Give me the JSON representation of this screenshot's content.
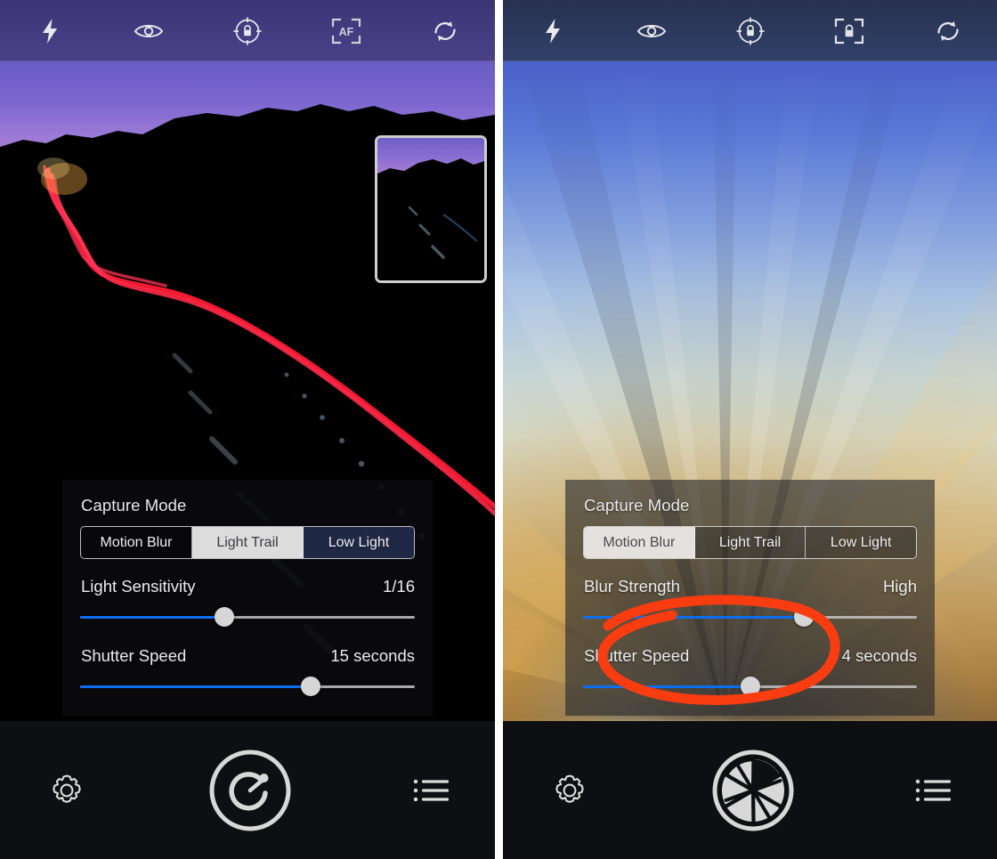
{
  "app": {
    "type": "mobile-camera-app-long-exposure",
    "panel_count": 2
  },
  "screens": [
    {
      "id": "left",
      "top_bar": {
        "buttons": [
          {
            "name": "flash-icon",
            "label": "Flash"
          },
          {
            "name": "eye-icon",
            "label": "Preview"
          },
          {
            "name": "exposure-lock-icon",
            "label": "AE Lock"
          },
          {
            "name": "af-icon",
            "label": "AF",
            "text": "AF"
          },
          {
            "name": "camera-flip-icon",
            "label": "Switch Camera"
          }
        ],
        "bg_color": "#443c80"
      },
      "thumbnail": {
        "label": "Last Capture Preview"
      },
      "panel": {
        "title": "Capture Mode",
        "segments": [
          {
            "label": "Motion Blur",
            "state": "normal"
          },
          {
            "label": "Light Trail",
            "state": "selected"
          },
          {
            "label": "Low Light",
            "state": "tinted"
          }
        ],
        "controls": [
          {
            "label": "Light Sensitivity",
            "value": "1/16",
            "slider_percent": 43
          },
          {
            "label": "Shutter Speed",
            "value": "15 seconds",
            "slider_percent": 69
          }
        ]
      },
      "bottom_bar": {
        "settings_label": "Settings",
        "shutter_label": "Timer Shutter",
        "menu_label": "Library"
      }
    },
    {
      "id": "right",
      "top_bar": {
        "buttons": [
          {
            "name": "flash-icon",
            "label": "Flash"
          },
          {
            "name": "eye-icon",
            "label": "Preview"
          },
          {
            "name": "exposure-lock-icon",
            "label": "AE Lock"
          },
          {
            "name": "af-lock-icon",
            "label": "AF Lock",
            "text": ""
          },
          {
            "name": "camera-flip-icon",
            "label": "Switch Camera"
          }
        ],
        "bg_color": "#2d3a5e"
      },
      "panel": {
        "title": "Capture Mode",
        "segments": [
          {
            "label": "Motion Blur",
            "state": "selected"
          },
          {
            "label": "Light Trail",
            "state": "normal"
          },
          {
            "label": "Low Light",
            "state": "normal"
          }
        ],
        "controls": [
          {
            "label": "Blur Strength",
            "value": "High",
            "slider_percent": 66
          },
          {
            "label": "Shutter Speed",
            "value": "4 seconds",
            "slider_percent": 50
          }
        ]
      },
      "annotation": {
        "shape": "hand-drawn-ellipse",
        "color": "#fa3c11",
        "target": "Shutter Speed slider"
      },
      "bottom_bar": {
        "settings_label": "Settings",
        "shutter_label": "Aperture Shutter",
        "menu_label": "Library"
      }
    }
  ],
  "colors": {
    "slider_fill": "#0b6ef0",
    "slider_track": "#c3c3c3",
    "knob": "#d6d6d6",
    "annotation_red": "#fa3c11",
    "bottom_bar": "#0e0f12"
  }
}
